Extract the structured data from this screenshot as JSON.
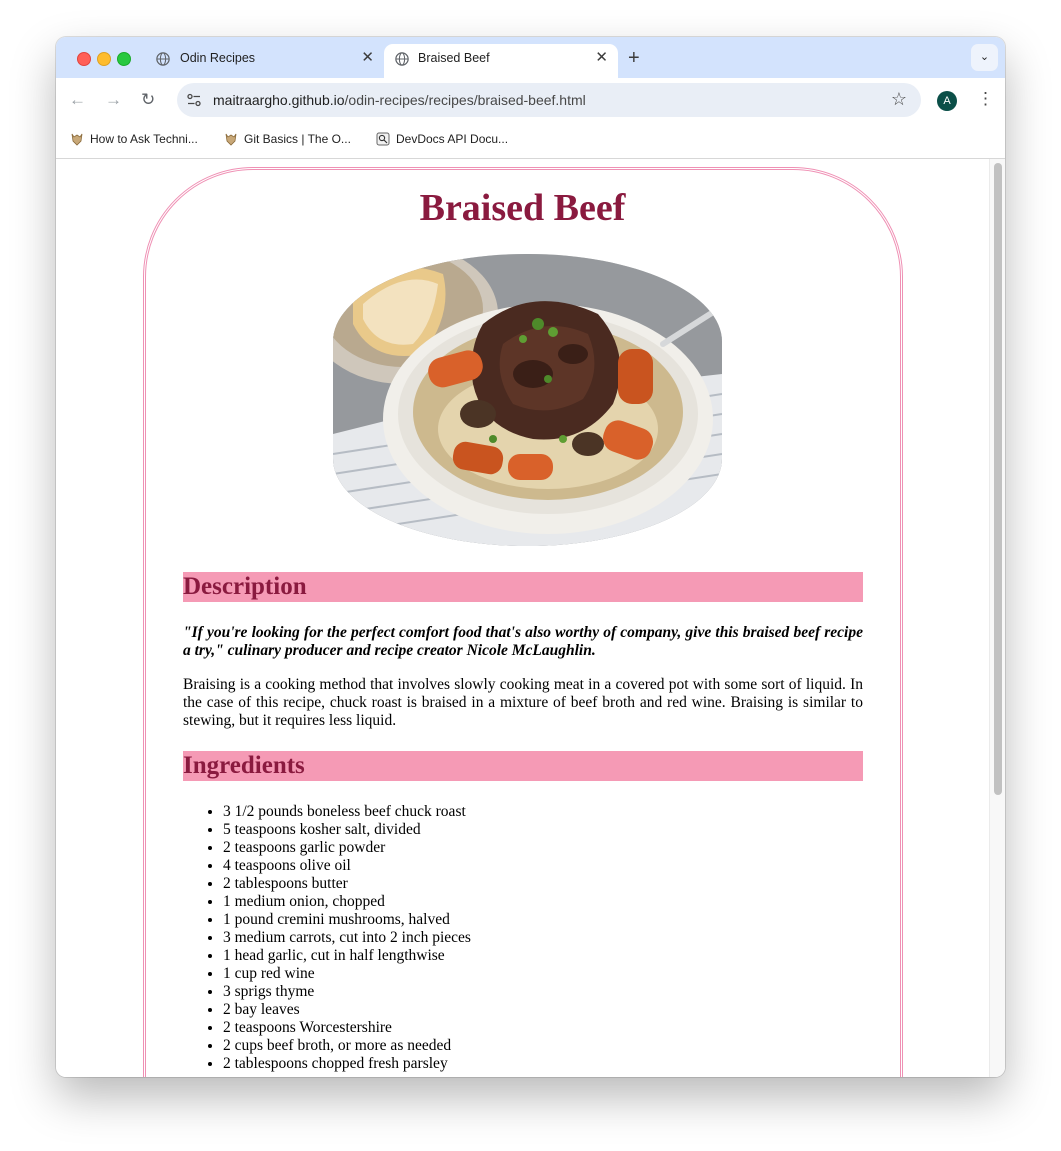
{
  "browser": {
    "tabs": [
      {
        "title": "Odin Recipes",
        "active": false
      },
      {
        "title": "Braised Beef",
        "active": true
      }
    ],
    "new_tab_label": "+",
    "url_host": "maitraargho.github.io",
    "url_path": "/odin-recipes/recipes/braised-beef.html",
    "profile_initial": "A",
    "bookmarks": [
      {
        "label": "How to Ask Techni...",
        "icon": "odin-icon"
      },
      {
        "label": "Git Basics | The O...",
        "icon": "odin-icon"
      },
      {
        "label": "DevDocs API Docu...",
        "icon": "devdocs-icon"
      }
    ]
  },
  "page": {
    "title": "Braised Beef",
    "image_alt": "braised beef",
    "description_heading": "Description",
    "quote": "\"If you're looking for the perfect comfort food that's also worthy of company, give this braised beef recipe a try,\" culinary producer and recipe creator Nicole McLaughlin.",
    "description": "Braising is a cooking method that involves slowly cooking meat in a covered pot with some sort of liquid. In the case of this recipe, chuck roast is braised in a mixture of beef broth and red wine. Braising is similar to stewing, but it requires less liquid.",
    "ingredients_heading": "Ingredients",
    "ingredients": [
      "3 1/2 pounds boneless beef chuck roast",
      "5 teaspoons kosher salt, divided",
      "2 teaspoons garlic powder",
      "4 teaspoons olive oil",
      "2 tablespoons butter",
      "1 medium onion, chopped",
      "1 pound cremini mushrooms, halved",
      "3 medium carrots, cut into 2 inch pieces",
      "1 head garlic, cut in half lengthwise",
      "1 cup red wine",
      "3 sprigs thyme",
      "2 bay leaves",
      "2 teaspoons Worcestershire",
      "2 cups beef broth, or more as needed",
      "2 tablespoons chopped fresh parsley"
    ]
  },
  "colors": {
    "title": "#8a1a3f",
    "heading_bg": "#f59ab5",
    "card_border": "#ef90b4",
    "tabbar": "#d3e3fd"
  }
}
